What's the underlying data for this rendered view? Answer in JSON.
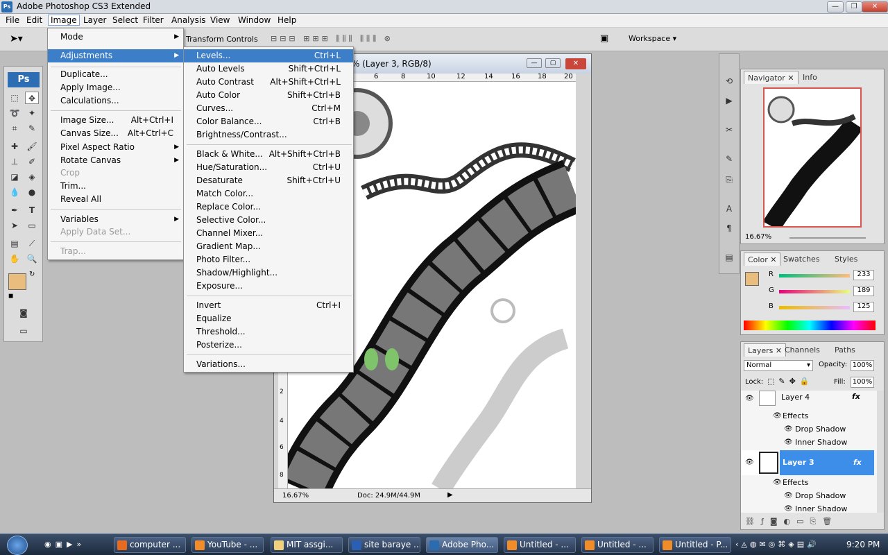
{
  "window": {
    "title": "Adobe Photoshop CS3 Extended",
    "logo": "Ps"
  },
  "menubar": [
    "File",
    "Edit",
    "Image",
    "Layer",
    "Select",
    "Filter",
    "Analysis",
    "View",
    "Window",
    "Help"
  ],
  "optionsbar": {
    "transform_label": "Transform Controls",
    "workspace": "Workspace"
  },
  "toolbox": {
    "logo": "Ps"
  },
  "image_menu": [
    {
      "label": "Mode",
      "submenu": true
    },
    {
      "label": "Adjustments",
      "submenu": true,
      "highlight": true
    },
    {
      "label": "Duplicate..."
    },
    {
      "label": "Apply Image..."
    },
    {
      "label": "Calculations..."
    },
    {
      "label": "Image Size...",
      "shortcut": "Alt+Ctrl+I"
    },
    {
      "label": "Canvas Size...",
      "shortcut": "Alt+Ctrl+C"
    },
    {
      "label": "Pixel Aspect Ratio",
      "submenu": true
    },
    {
      "label": "Rotate Canvas",
      "submenu": true
    },
    {
      "label": "Crop",
      "disabled": true
    },
    {
      "label": "Trim..."
    },
    {
      "label": "Reveal All"
    },
    {
      "label": "Variables",
      "submenu": true
    },
    {
      "label": "Apply Data Set...",
      "disabled": true
    },
    {
      "label": "Trap...",
      "disabled": true
    }
  ],
  "adjustments_menu": [
    {
      "label": "Levels...",
      "shortcut": "Ctrl+L",
      "highlight": true
    },
    {
      "label": "Auto Levels",
      "shortcut": "Shift+Ctrl+L"
    },
    {
      "label": "Auto Contrast",
      "shortcut": "Alt+Shift+Ctrl+L"
    },
    {
      "label": "Auto Color",
      "shortcut": "Shift+Ctrl+B"
    },
    {
      "label": "Curves...",
      "shortcut": "Ctrl+M"
    },
    {
      "label": "Color Balance...",
      "shortcut": "Ctrl+B"
    },
    {
      "label": "Brightness/Contrast..."
    },
    {
      "label": "Black & White...",
      "shortcut": "Alt+Shift+Ctrl+B"
    },
    {
      "label": "Hue/Saturation...",
      "shortcut": "Ctrl+U"
    },
    {
      "label": "Desaturate",
      "shortcut": "Shift+Ctrl+U"
    },
    {
      "label": "Match Color..."
    },
    {
      "label": "Replace Color..."
    },
    {
      "label": "Selective Color..."
    },
    {
      "label": "Channel Mixer..."
    },
    {
      "label": "Gradient Map..."
    },
    {
      "label": "Photo Filter..."
    },
    {
      "label": "Shadow/Highlight..."
    },
    {
      "label": "Exposure..."
    },
    {
      "label": "Invert",
      "shortcut": "Ctrl+I"
    },
    {
      "label": "Equalize"
    },
    {
      "label": "Threshold..."
    },
    {
      "label": "Posterize..."
    },
    {
      "label": "Variations..."
    }
  ],
  "document": {
    "title": "% (Layer 3, RGB/8)",
    "ruler_top": [
      "6",
      "8",
      "10",
      "12",
      "14",
      "16",
      "18",
      "20"
    ],
    "ruler_left": [
      "2",
      "4",
      "6",
      "8"
    ],
    "zoom": "16.67%",
    "doc_size": "Doc: 24.9M/44.9M"
  },
  "navigator": {
    "tabs": [
      "Navigator",
      "Info"
    ],
    "zoom": "16.67%"
  },
  "color_panel": {
    "tabs": [
      "Color",
      "Swatches",
      "Styles"
    ],
    "channels": [
      {
        "label": "R",
        "value": "233"
      },
      {
        "label": "G",
        "value": "189"
      },
      {
        "label": "B",
        "value": "125"
      }
    ],
    "foreground": "#e9bd7d"
  },
  "layers_panel": {
    "tabs": [
      "Layers",
      "Channels",
      "Paths"
    ],
    "blend_mode": "Normal",
    "opacity_label": "Opacity:",
    "opacity": "100%",
    "lock_label": "Lock:",
    "fill_label": "Fill:",
    "fill": "100%",
    "layers": [
      {
        "name": "Layer 4",
        "fx": "fx",
        "effects_label": "Effects",
        "effects": [
          "Drop Shadow",
          "Inner Shadow"
        ]
      },
      {
        "name": "Layer 3",
        "fx": "fx",
        "selected": true,
        "effects_label": "Effects",
        "effects": [
          "Drop Shadow",
          "Inner Shadow"
        ]
      }
    ]
  },
  "taskbar": {
    "items": [
      "computer ...",
      "YouTube - ...",
      "MIT assgi...",
      "site baraye ...",
      "Adobe Pho...",
      "Untitled - ...",
      "Untitled - ...",
      "Untitled - P..."
    ],
    "clock": "9:20 PM"
  }
}
